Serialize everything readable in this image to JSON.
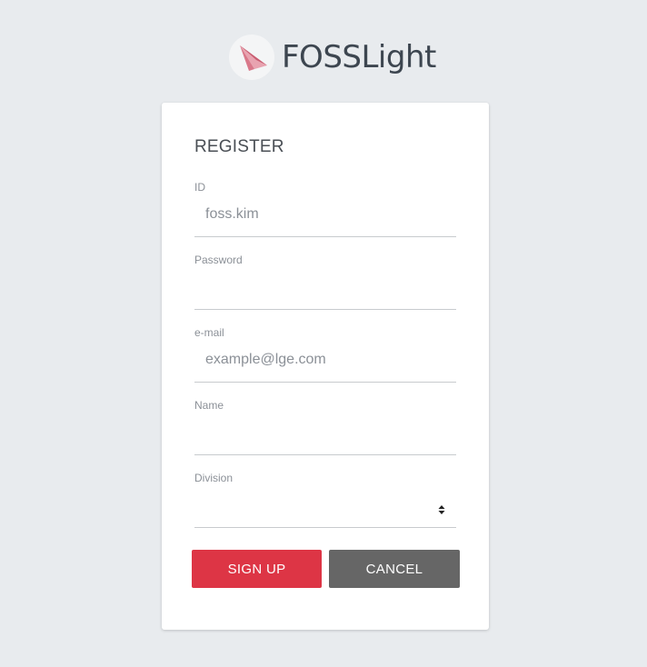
{
  "brand": {
    "name": "FOSSLight",
    "logo_icon": "paper-plane-logo-icon"
  },
  "form": {
    "title": "REGISTER",
    "fields": {
      "id": {
        "label": "ID",
        "placeholder": "foss.kim",
        "value": ""
      },
      "password": {
        "label": "Password",
        "placeholder": "",
        "value": ""
      },
      "email": {
        "label": "e-mail",
        "placeholder": "example@lge.com",
        "value": ""
      },
      "name": {
        "label": "Name",
        "placeholder": "",
        "value": ""
      },
      "division": {
        "label": "Division",
        "selected": "",
        "icon": "sort-arrows-icon"
      }
    },
    "buttons": {
      "signup_label": "SIGN UP",
      "cancel_label": "CANCEL"
    }
  },
  "colors": {
    "background": "#e8ebee",
    "primary_button": "#dd3545",
    "secondary_button": "#666666",
    "logo_accent": "#d9788a"
  }
}
